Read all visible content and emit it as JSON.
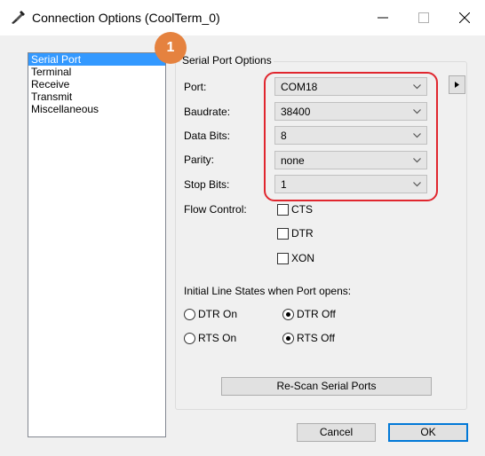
{
  "window": {
    "title": "Connection Options (CoolTerm_0)"
  },
  "sidebar": {
    "items": [
      {
        "label": "Serial Port",
        "selected": true
      },
      {
        "label": "Terminal"
      },
      {
        "label": "Receive"
      },
      {
        "label": "Transmit"
      },
      {
        "label": "Miscellaneous"
      }
    ]
  },
  "serial_port_options": {
    "group_title": "Serial Port Options",
    "port": {
      "label": "Port:",
      "value": "COM18"
    },
    "baudrate": {
      "label": "Baudrate:",
      "value": "38400"
    },
    "data_bits": {
      "label": "Data Bits:",
      "value": "8"
    },
    "parity": {
      "label": "Parity:",
      "value": "none"
    },
    "stop_bits": {
      "label": "Stop Bits:",
      "value": "1"
    },
    "flow_control": {
      "label": "Flow Control:",
      "cts": {
        "label": "CTS",
        "checked": false
      },
      "dtr": {
        "label": "DTR",
        "checked": false
      },
      "xon": {
        "label": "XON",
        "checked": false
      }
    },
    "initial_line_states": {
      "label": "Initial Line States when Port opens:",
      "dtr_on": {
        "label": "DTR On",
        "selected": false
      },
      "dtr_off": {
        "label": "DTR Off",
        "selected": true
      },
      "rts_on": {
        "label": "RTS On",
        "selected": false
      },
      "rts_off": {
        "label": "RTS Off",
        "selected": true
      }
    },
    "rescan_label": "Re-Scan Serial Ports"
  },
  "buttons": {
    "cancel": "Cancel",
    "ok": "OK"
  },
  "annotation": {
    "badge_number": "1",
    "badge_color": "#e5823f",
    "highlight_color": "#e0262e"
  },
  "colors": {
    "selection": "#3399ff",
    "default_button_border": "#0078d7"
  }
}
